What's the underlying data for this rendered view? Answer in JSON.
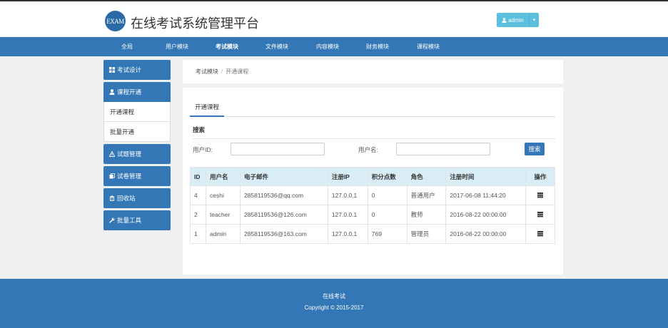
{
  "header": {
    "logo_text": "EXAM",
    "title": "在线考试系统管理平台",
    "user_label": "admin"
  },
  "nav": {
    "items": [
      {
        "label": "全局"
      },
      {
        "label": "用户模块"
      },
      {
        "label": "考试模块",
        "active": true
      },
      {
        "label": "文件模块"
      },
      {
        "label": "内容模块"
      },
      {
        "label": "财务模块"
      },
      {
        "label": "课程模块"
      }
    ]
  },
  "sidebar": {
    "items": [
      {
        "label": "考试设计",
        "icon": "th-large-icon"
      },
      {
        "label": "课程开通",
        "icon": "user-icon",
        "children": [
          "开通课程",
          "批量开通"
        ]
      },
      {
        "label": "试题管理",
        "icon": "warning-triangle-icon"
      },
      {
        "label": "试卷管理",
        "icon": "copy-icon"
      },
      {
        "label": "回收站",
        "icon": "trash-icon"
      },
      {
        "label": "批量工具",
        "icon": "wrench-icon"
      }
    ]
  },
  "breadcrumb": {
    "parent": "考试模块",
    "separator": "/",
    "current": "开通课程"
  },
  "panel": {
    "tab_label": "开通课程",
    "search_title": "搜索",
    "user_id_label": "用户ID:",
    "username_label": "用户名:",
    "user_id_value": "",
    "username_value": "",
    "search_button": "搜索"
  },
  "table": {
    "headers": [
      "ID",
      "用户名",
      "电子邮件",
      "注册IP",
      "积分点数",
      "角色",
      "注册时间",
      "操作"
    ],
    "rows": [
      [
        "4",
        "ceshi",
        "2858119536@qq.com",
        "127.0.0.1",
        "0",
        "普通用户",
        "2017-06-08 11:44:20"
      ],
      [
        "2",
        "teacher",
        "2858119536@126.com",
        "127.0.0.1",
        "0",
        "教师",
        "2016-08-22 00:00:00"
      ],
      [
        "1",
        "admin",
        "2858119536@163.com",
        "127.0.0.1",
        "769",
        "管理员",
        "2016-08-22 00:00:00"
      ]
    ]
  },
  "footer": {
    "line1": "在线考试",
    "line2": "Copyright © 2015-2017"
  },
  "colors": {
    "primary": "#3377b6",
    "info": "#5bc0de",
    "table_header_bg": "#d9edf7"
  }
}
